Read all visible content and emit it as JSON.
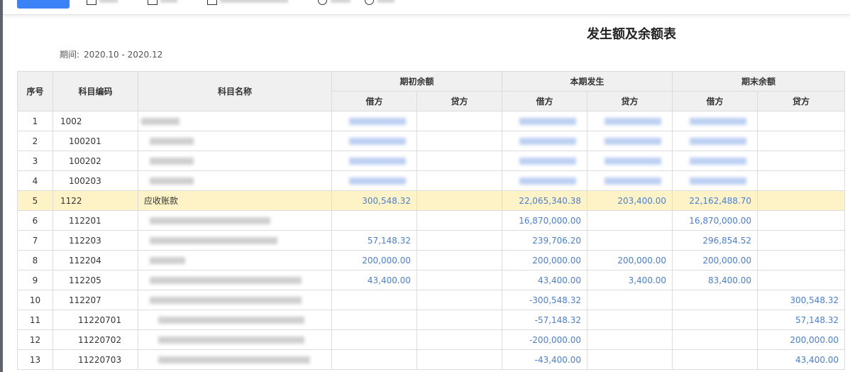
{
  "report": {
    "title": "发生额及余额表",
    "period_label": "期间:",
    "period_value": "2020.10 - 2020.12"
  },
  "table": {
    "headers": {
      "index": "序号",
      "code": "科目编码",
      "name": "科目名称",
      "opening": "期初余额",
      "current": "本期发生",
      "closing": "期末余额",
      "debit": "借方",
      "credit": "贷方"
    },
    "rows": [
      {
        "index": "1",
        "code": "1002",
        "name": "",
        "od": "",
        "oc": "",
        "cd": "",
        "cc": "",
        "ed": "",
        "ec": ""
      },
      {
        "index": "2",
        "code": "100201",
        "name": "",
        "od": "",
        "oc": "",
        "cd": "",
        "cc": "",
        "ed": "",
        "ec": ""
      },
      {
        "index": "3",
        "code": "100202",
        "name": "",
        "od": "",
        "oc": "",
        "cd": "",
        "cc": "",
        "ed": "",
        "ec": ""
      },
      {
        "index": "4",
        "code": "100203",
        "name": "",
        "od": "",
        "oc": "",
        "cd": "",
        "cc": "",
        "ed": "",
        "ec": ""
      },
      {
        "index": "5",
        "code": "1122",
        "name": "应收账款",
        "od": "300,548.32",
        "oc": "",
        "cd": "22,065,340.38",
        "cc": "203,400.00",
        "ed": "22,162,488.70",
        "ec": ""
      },
      {
        "index": "6",
        "code": "112201",
        "name": "",
        "od": "",
        "oc": "",
        "cd": "16,870,000.00",
        "cc": "",
        "ed": "16,870,000.00",
        "ec": ""
      },
      {
        "index": "7",
        "code": "112203",
        "name": "",
        "od": "57,148.32",
        "oc": "",
        "cd": "239,706.20",
        "cc": "",
        "ed": "296,854.52",
        "ec": ""
      },
      {
        "index": "8",
        "code": "112204",
        "name": "",
        "od": "200,000.00",
        "oc": "",
        "cd": "200,000.00",
        "cc": "200,000.00",
        "ed": "200,000.00",
        "ec": ""
      },
      {
        "index": "9",
        "code": "112205",
        "name": "",
        "od": "43,400.00",
        "oc": "",
        "cd": "43,400.00",
        "cc": "3,400.00",
        "ed": "83,400.00",
        "ec": ""
      },
      {
        "index": "10",
        "code": "112207",
        "name": "",
        "od": "",
        "oc": "",
        "cd": "-300,548.32",
        "cc": "",
        "ed": "",
        "ec": "300,548.32"
      },
      {
        "index": "11",
        "code": "11220701",
        "name": "",
        "od": "",
        "oc": "",
        "cd": "-57,148.32",
        "cc": "",
        "ed": "",
        "ec": "57,148.32"
      },
      {
        "index": "12",
        "code": "11220702",
        "name": "",
        "od": "",
        "oc": "",
        "cd": "-200,000.00",
        "cc": "",
        "ed": "",
        "ec": "200,000.00"
      },
      {
        "index": "13",
        "code": "11220703",
        "name": "",
        "od": "",
        "oc": "",
        "cd": "-43,400.00",
        "cc": "",
        "ed": "",
        "ec": "43,400.00"
      }
    ]
  },
  "colors": {
    "accent": "#3b82f6",
    "amount_text": "#4a7fd6",
    "highlight_row": "#fdf3c6",
    "header_bg": "#f0f0f0"
  }
}
